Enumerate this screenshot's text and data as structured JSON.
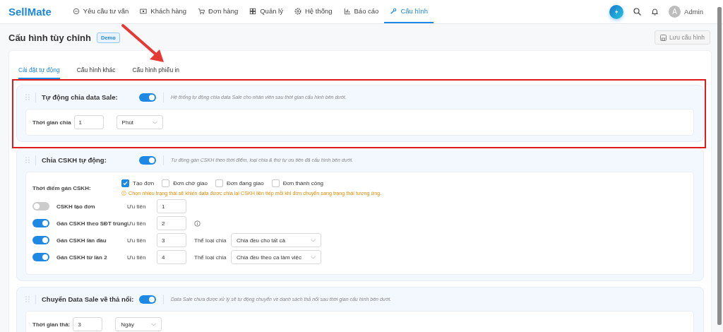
{
  "nav": {
    "logo": "SellMate",
    "items": [
      {
        "label": "Yêu cầu tư vấn",
        "selected": false
      },
      {
        "label": "Khách hàng",
        "selected": false
      },
      {
        "label": "Đơn hàng",
        "selected": false
      },
      {
        "label": "Quản lý",
        "selected": false
      },
      {
        "label": "Hệ thống",
        "selected": false
      },
      {
        "label": "Báo cáo",
        "selected": false
      },
      {
        "label": "Cấu hình",
        "selected": true
      }
    ],
    "avatar": "A",
    "user": "Admin"
  },
  "header": {
    "title": "Cấu hình tùy chỉnh",
    "badge": "Demo",
    "save_button": {
      "label": "Lưu cấu hình",
      "disabled": true
    }
  },
  "tabs": [
    {
      "label": "Cài đặt tự động",
      "selected": true
    },
    {
      "label": "Cấu hình khác",
      "selected": false
    },
    {
      "label": "Cấu hình phiếu in",
      "selected": false
    }
  ],
  "sections": [
    {
      "title": "Tự động chia data Sale:",
      "on": true,
      "description": "Hệ thống tự động chia data Sale cho nhân viên sau thời gian cấu hình bên dưới.",
      "kind": "duration",
      "duration": {
        "label": "Thời gian chia",
        "value": "1",
        "unit": "Phút"
      }
    },
    {
      "title": "Chia CSKH tự động:",
      "on": true,
      "description": "Tự động gán CSKH theo thời điểm, loại chia & thứ tự ưu tiên đã cấu hình bên dưới.",
      "kind": "rules",
      "timing_label": "Thời điểm gán CSKH:",
      "checkboxes": [
        {
          "label": "Tạo đơn",
          "checked": true
        },
        {
          "label": "Đơn chờ giao",
          "checked": false
        },
        {
          "label": "Đơn đang giao",
          "checked": false
        },
        {
          "label": "Đơn thành công",
          "checked": false
        }
      ],
      "warning": "Chọn nhiều trạng thái sẽ khiến data được chia lại CSKH liên tiếp mỗi khi đơn chuyển sang trạng thái tương ứng.",
      "rules": [
        {
          "name": "CSKH tạo đơn",
          "on": false,
          "priority_label": "Ưu tiên",
          "priority": "1",
          "info": false
        },
        {
          "name": "Gán CSKH theo SĐT trùng",
          "on": true,
          "priority_label": "Ưu tiên",
          "priority": "2",
          "info": true
        },
        {
          "name": "Gán CSKH lần đầu",
          "on": true,
          "priority_label": "Ưu tiên",
          "priority": "3",
          "info": false,
          "type_label": "Thể loại chia",
          "type_value": "Chia đều cho tất cả"
        },
        {
          "name": "Gán CSKH từ lần 2",
          "on": true,
          "priority_label": "Ưu tiên",
          "priority": "4",
          "info": false,
          "type_label": "Thể loại chia",
          "type_value": "Chia đều theo ca làm việc"
        }
      ]
    },
    {
      "title": "Chuyển Data Sale về thả nổi:",
      "on": true,
      "description": "Data Sale chưa được xử lý sẽ tự động chuyển về danh sách thả nổi sau thời gian cấu hình bên dưới.",
      "kind": "duration",
      "duration": {
        "label": "Thời gian thả:",
        "value": "3",
        "unit": "Ngày"
      }
    }
  ]
}
